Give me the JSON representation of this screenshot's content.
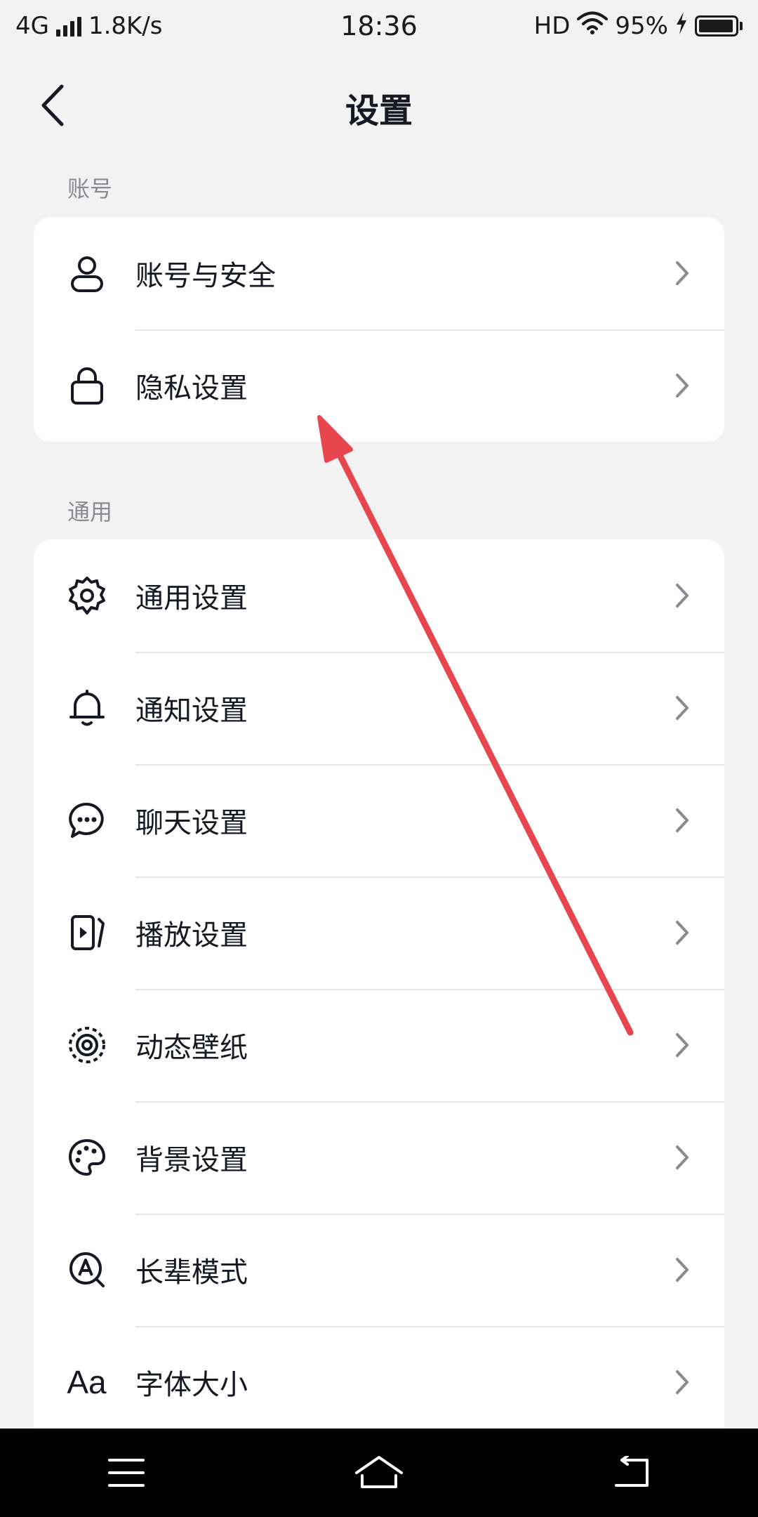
{
  "status_bar": {
    "network": "4G",
    "speed": "1.8K/s",
    "time": "18:36",
    "hd": "HD",
    "battery": "95%",
    "battery_level": 0.95
  },
  "header": {
    "title": "设置"
  },
  "sections": [
    {
      "label": "账号",
      "items": [
        {
          "label": "账号与安全",
          "icon": "person-icon"
        },
        {
          "label": "隐私设置",
          "icon": "lock-icon"
        }
      ]
    },
    {
      "label": "通用",
      "items": [
        {
          "label": "通用设置",
          "icon": "gear-icon"
        },
        {
          "label": "通知设置",
          "icon": "bell-icon"
        },
        {
          "label": "聊天设置",
          "icon": "chat-bubble-icon"
        },
        {
          "label": "播放设置",
          "icon": "play-screen-icon"
        },
        {
          "label": "动态壁纸",
          "icon": "live-wallpaper-icon"
        },
        {
          "label": "背景设置",
          "icon": "palette-icon"
        },
        {
          "label": "长辈模式",
          "icon": "elder-mode-icon"
        },
        {
          "label": "字体大小",
          "icon": "font-size-icon",
          "icon_text": "Aa"
        }
      ]
    }
  ],
  "colors": {
    "background": "#f2f2f2",
    "card": "#ffffff",
    "text": "#161823",
    "secondary_text": "#8a8b91",
    "chevron": "#8a8b91",
    "annotation_arrow": "#e8464f"
  }
}
